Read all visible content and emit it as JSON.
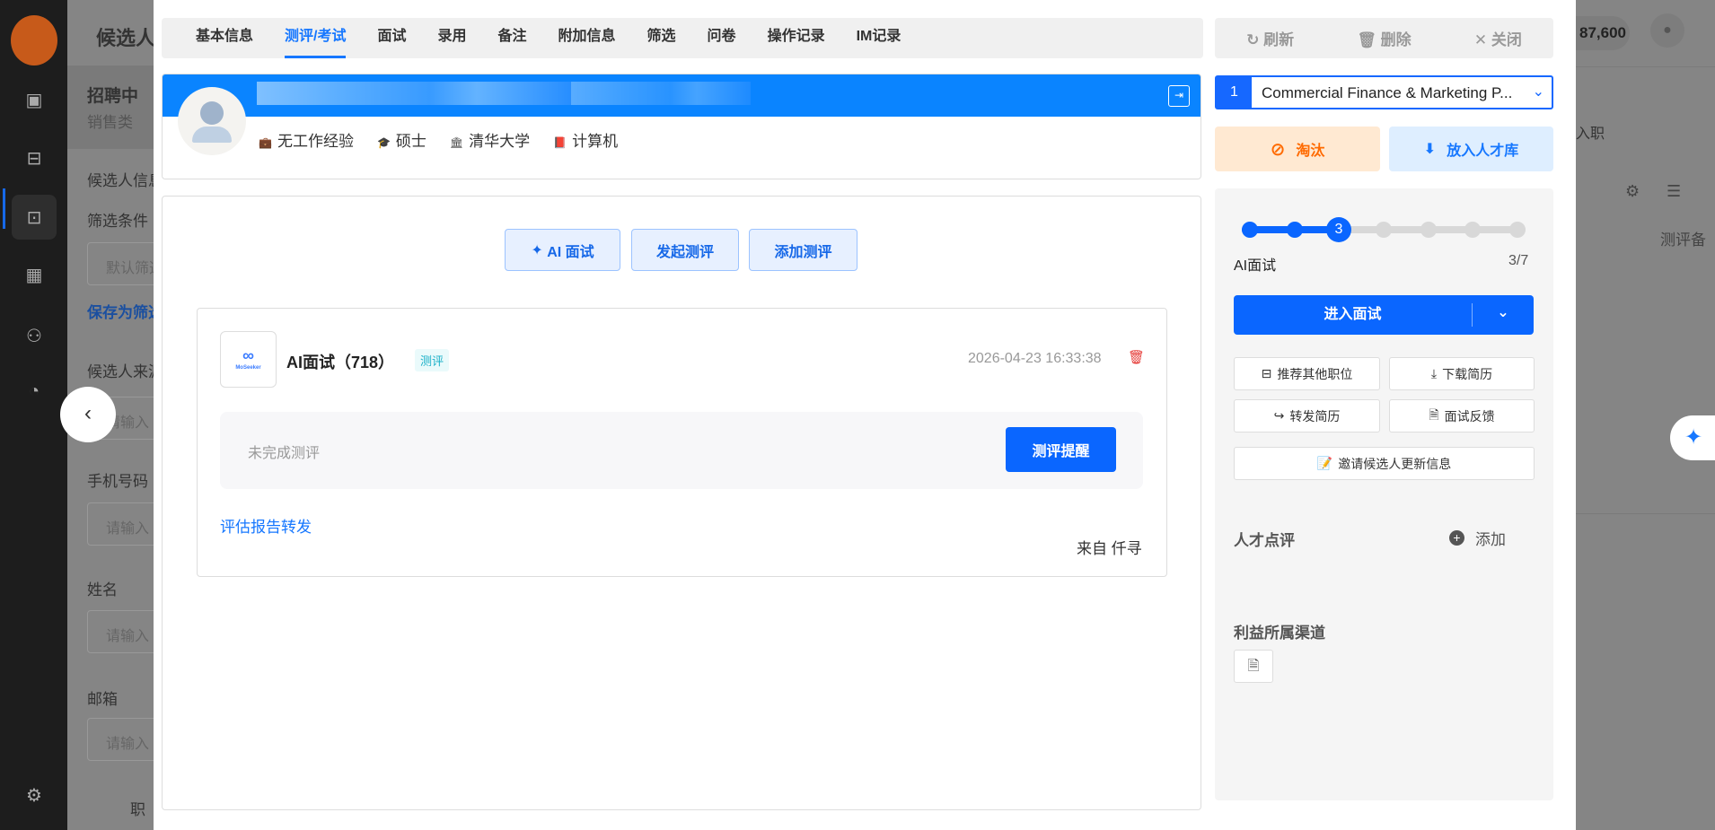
{
  "background": {
    "page_title": "候选人",
    "status_title": "招聘中",
    "status_sub": "销售类",
    "labels": [
      "候选人信息",
      "筛选条件",
      "候选人来源",
      "手机号码",
      "姓名",
      "邮箱"
    ],
    "filter_value": "默认筛选",
    "save_link": "保存为筛选",
    "input_placeholder": "请输入",
    "bottom_text": "职",
    "top_count": "87,600",
    "col_text": "入职",
    "col_text2": "测评备"
  },
  "tabs": [
    {
      "label": "基本信息"
    },
    {
      "label": "测评/考试"
    },
    {
      "label": "面试"
    },
    {
      "label": "录用"
    },
    {
      "label": "备注"
    },
    {
      "label": "附加信息"
    },
    {
      "label": "筛选"
    },
    {
      "label": "问卷"
    },
    {
      "label": "操作记录"
    },
    {
      "label": "IM记录"
    }
  ],
  "actions": {
    "refresh": "刷新",
    "delete": "删除",
    "close": "关闭"
  },
  "profile": {
    "experience": "无工作经验",
    "degree": "硕士",
    "school": "清华大学",
    "major": "计算机"
  },
  "assessment": {
    "ai_interview_btn": "AI 面试",
    "start_btn": "发起测评",
    "add_btn": "添加测评",
    "card": {
      "title": "AI面试（718）",
      "tag": "测评",
      "time": "2026-04-23 16:33:38",
      "status": "未完成测评",
      "remind_btn": "测评提醒",
      "forward_link": "评估报告转发",
      "source": "来自 仟寻"
    }
  },
  "job": {
    "index": "1",
    "name": "Commercial Finance & Marketing P..."
  },
  "reject_btn": "淘汰",
  "talent_pool_btn": "放入人才库",
  "progress": {
    "current": 3,
    "total": 7,
    "stage": "AI面试",
    "ratio": "3/7"
  },
  "enter_interview": "进入面试",
  "ops": {
    "recommend": "推荐其他职位",
    "download": "下载简历",
    "forward": "转发简历",
    "feedback": "面试反馈",
    "invite": "邀请候选人更新信息"
  },
  "talent_review": {
    "title": "人才点评",
    "add": "添加"
  },
  "channel": {
    "title": "利益所属渠道"
  },
  "colors": {
    "primary": "#1668ff",
    "danger": "#ff6a00"
  }
}
